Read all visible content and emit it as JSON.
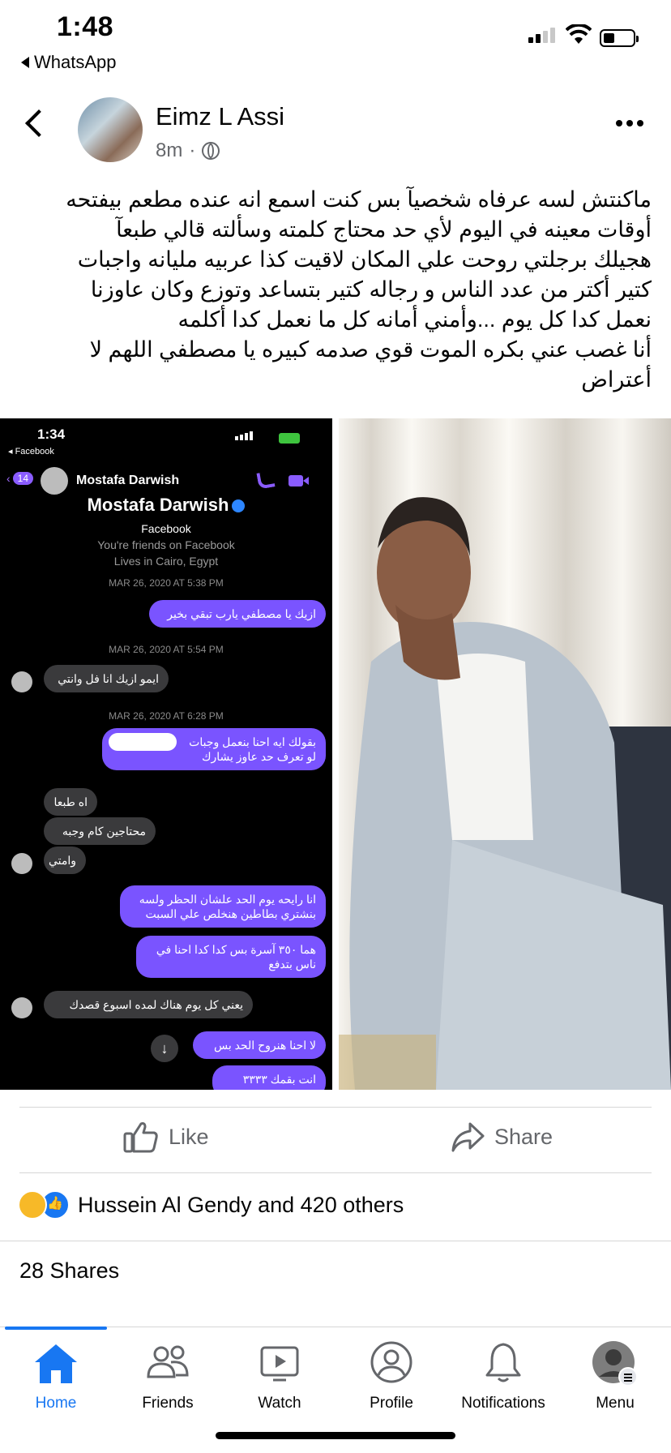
{
  "status_bar": {
    "time": "1:48",
    "back_app": "WhatsApp"
  },
  "post": {
    "author": "Eimz L Assi",
    "time_ago": "8m",
    "separator": "·",
    "text_lines": [
      "ماكنتش لسه عرفاه شخصيآ بس كنت اسمع انه عنده مطعم بيفتحه",
      "أوقات معينه في اليوم لأي حد محتاج كلمته وسألته قالي طبعآ",
      "هجيلك برجلتي روحت علي المكان لاقيت كذا عربيه مليانه واجبات",
      "كتير أكتر من عدد الناس و رجاله كتير بتساعد وتوزع وكان عاوزنا",
      "نعمل كدا كل يوم ...وأمني أمانه كل ما نعمل كدا أكلمه",
      "أنا غصب عني بكره الموت قوي صدمه كبيره يا مصطفي اللهم لا",
      "أعتراض"
    ]
  },
  "screenshot": {
    "time": "1:34",
    "back_label": "◂ Facebook",
    "back_count": "14",
    "contact_name": "Mostafa Darwish",
    "profile_source": "Facebook",
    "friends_line": "You're friends on Facebook",
    "location_line": "Lives in Cairo, Egypt",
    "dates": [
      "MAR 26, 2020 AT 5:38 PM",
      "MAR 26, 2020 AT 5:54 PM",
      "MAR 26, 2020 AT 6:28 PM"
    ],
    "messages": [
      "ازيك يا مصطفي يارب تبقي بخير",
      "ايمو ازيك انا فل وانتي",
      "بقولك ايه احنا بنعمل وجبات",
      "لو تعرف حد عاوز يشارك",
      "اه طبعا",
      "محتاجين كام وجبه",
      "وامتي",
      "انا رايحه يوم الحد علشان الحظر ولسه",
      "بنشتري بطاطين هنخلص علي السبت",
      "هما ٣٥٠ آسرة بس كدا كدا احنا في",
      "ناس بتدفع",
      "يعني كل يوم هناك لمده اسبوع قصدك",
      "لا احنا هنروح الحد بس",
      "انت بقمك ٣٣٣٣"
    ],
    "scroll_down_icon": "arrow-down-icon"
  },
  "actions": {
    "like": "Like",
    "share": "Share"
  },
  "reactions": {
    "text": "Hussein Al Gendy and 420 others",
    "icons": [
      "sad-reaction-icon",
      "like-reaction-icon"
    ]
  },
  "shares": "28 Shares",
  "nav": {
    "items": [
      {
        "label": "Home",
        "icon": "home-icon"
      },
      {
        "label": "Friends",
        "icon": "friends-icon"
      },
      {
        "label": "Watch",
        "icon": "watch-icon"
      },
      {
        "label": "Profile",
        "icon": "profile-icon"
      },
      {
        "label": "Notifications",
        "icon": "bell-icon"
      },
      {
        "label": "Menu",
        "icon": "menu-avatar-icon"
      }
    ],
    "active": "Home",
    "accent": "#1877f2"
  }
}
